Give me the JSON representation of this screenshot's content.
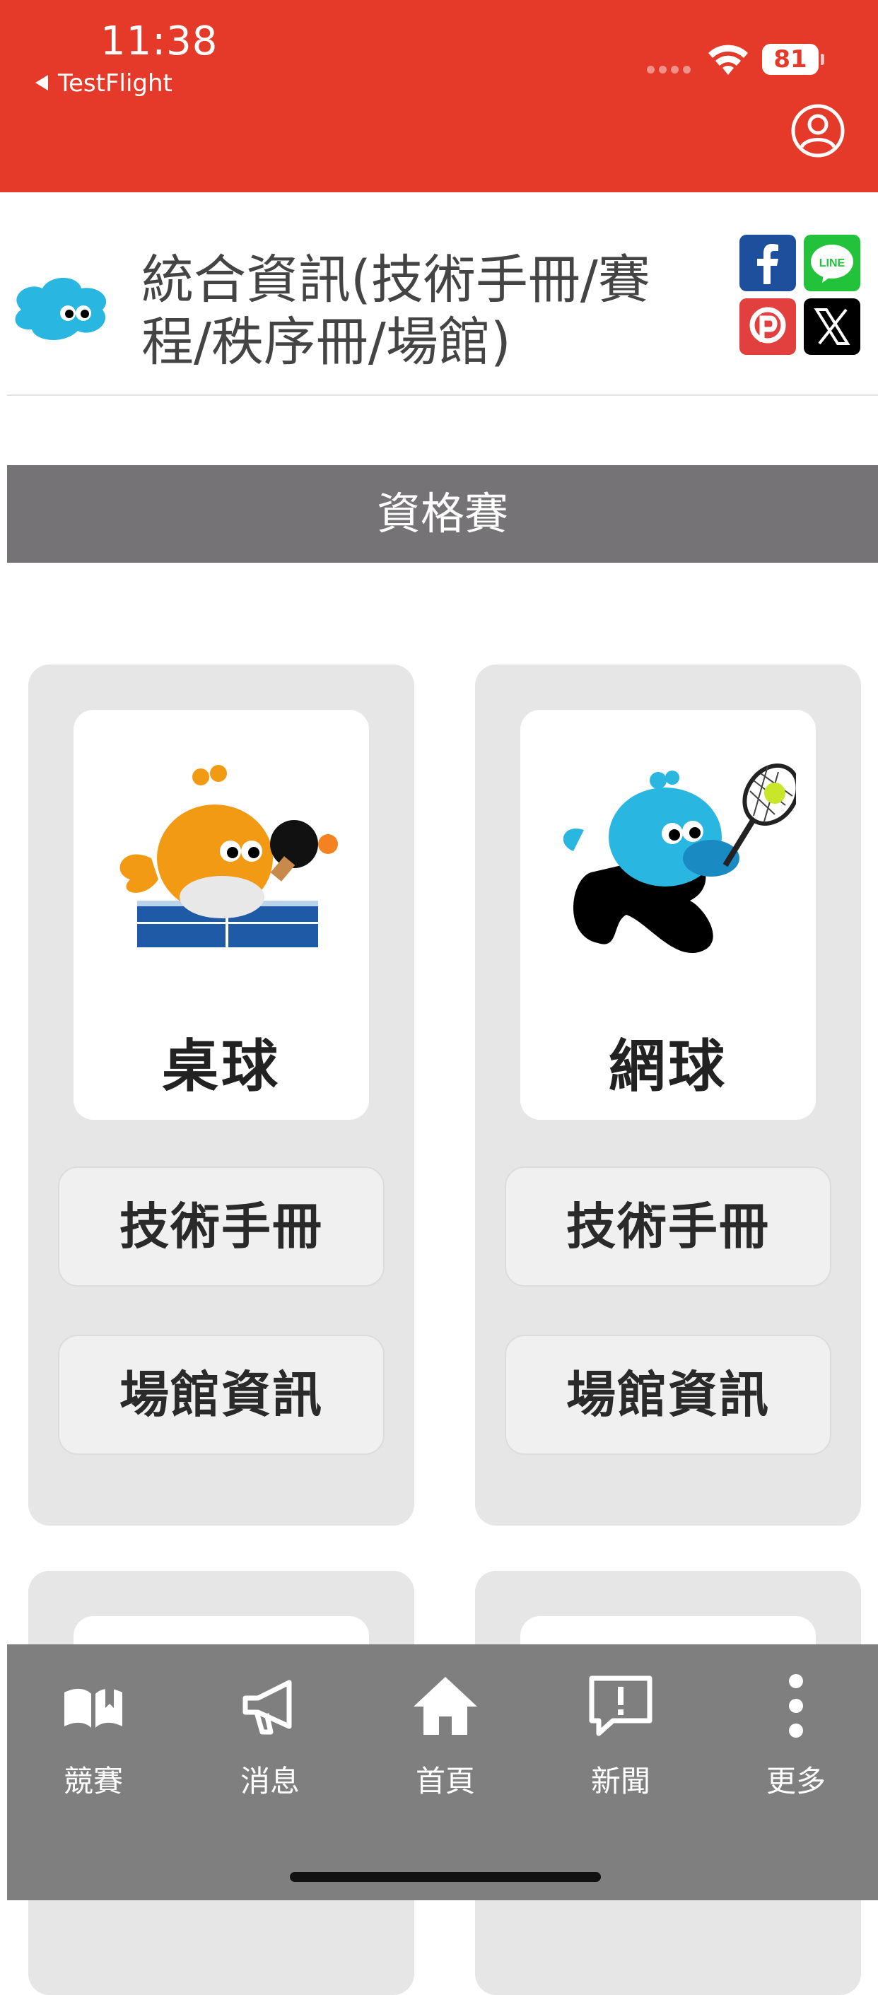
{
  "status": {
    "time": "11:38",
    "back_app": "TestFlight",
    "battery": "81"
  },
  "header": {
    "title": "統合資訊(技術手冊/賽程/秩序冊/場館)",
    "icons": [
      "user-profile-icon",
      "facebook-icon",
      "line-icon",
      "pixnet-icon",
      "x-icon"
    ],
    "accent_color": "#e5392a",
    "social_line_text": "LINE"
  },
  "section": {
    "title": "資格賽"
  },
  "cards": [
    {
      "sport": "桌球",
      "buttons": [
        "技術手冊",
        "場館資訊"
      ],
      "icon": "table-tennis-mascot-icon"
    },
    {
      "sport": "網球",
      "buttons": [
        "技術手冊",
        "場館資訊"
      ],
      "icon": "tennis-mascot-icon"
    }
  ],
  "tabbar": {
    "items": [
      {
        "label": "競賽",
        "icon": "book-icon"
      },
      {
        "label": "消息",
        "icon": "megaphone-icon"
      },
      {
        "label": "首頁",
        "icon": "home-icon"
      },
      {
        "label": "新聞",
        "icon": "news-alert-icon"
      },
      {
        "label": "更多",
        "icon": "more-vertical-icon"
      }
    ],
    "background": "#807f80"
  }
}
